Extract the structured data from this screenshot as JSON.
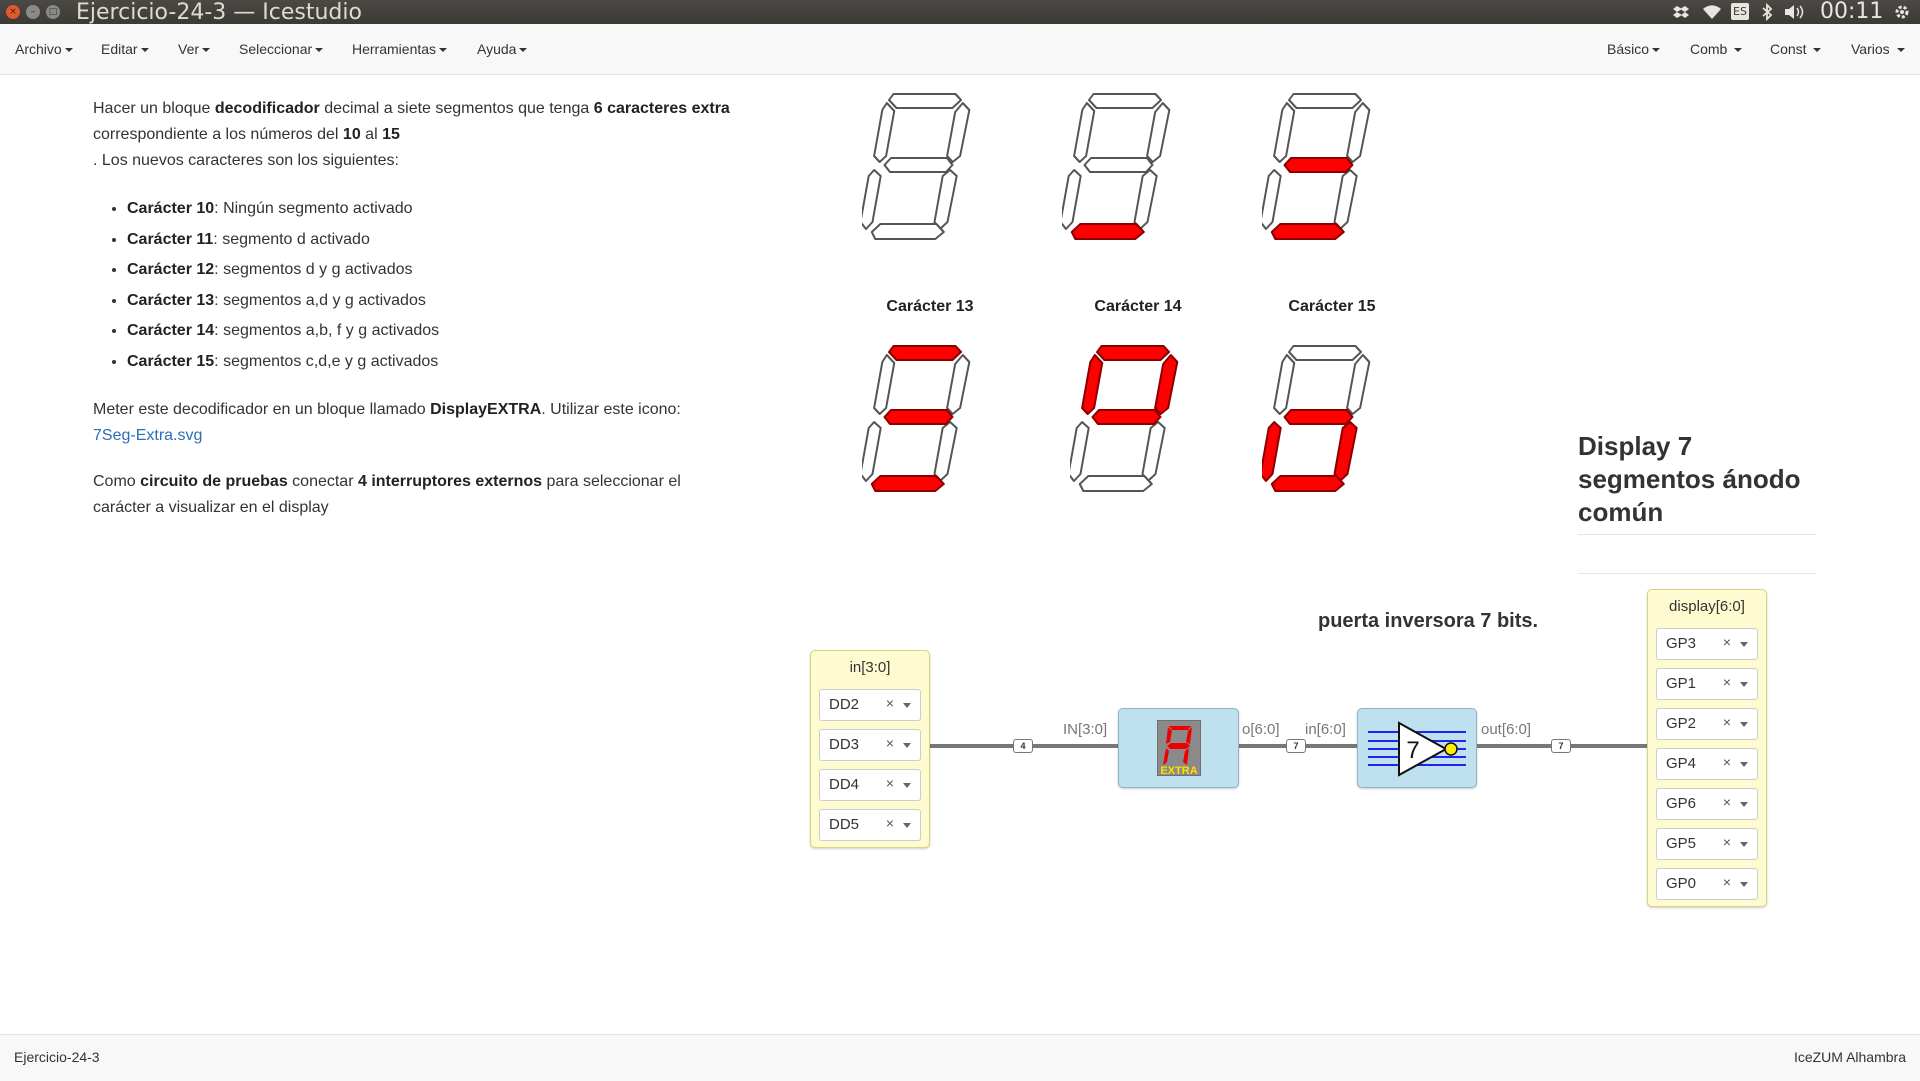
{
  "window": {
    "title": "Ejercicio-24-3 — Icestudio",
    "close_glyph": "×",
    "min_glyph": "–",
    "max_glyph": "□"
  },
  "tray": {
    "keyboard_layout": "ES",
    "clock": "00:11",
    "icons": [
      "dropbox-icon",
      "wifi-icon",
      "keyboard-icon",
      "bluetooth-icon",
      "volume-icon",
      "settings-icon"
    ]
  },
  "menu": {
    "left": [
      "Archivo",
      "Editar",
      "Ver",
      "Seleccionar",
      "Herramientas",
      "Ayuda"
    ],
    "right": [
      "Básico",
      "Comb",
      "Const",
      "Varios"
    ]
  },
  "info": {
    "p1": {
      "t1": "Hacer un bloque ",
      "b1": "decodificador",
      "t2": " decimal a siete segmentos que tenga ",
      "b2": "6 caracteres extra",
      "t3": " correspondiente a los números del ",
      "b3": "10",
      "t4": " al ",
      "b4": "15",
      "t5": ". Los nuevos caracteres son los siguientes:"
    },
    "items": [
      {
        "label": "Carácter 10",
        "desc": ": Ningún segmento activado"
      },
      {
        "label": "Carácter 11",
        "desc": ": segmento d activado"
      },
      {
        "label": "Carácter 12",
        "desc": ": segmentos d y g activados"
      },
      {
        "label": "Carácter 13",
        "desc": ": segmentos a,d y g activados"
      },
      {
        "label": "Carácter 14",
        "desc": ": segmentos a,b, f y g activados"
      },
      {
        "label": "Carácter 15",
        "desc": ": segmentos c,d,e y g activados"
      }
    ],
    "p2": {
      "t1": "Meter este decodificador en un bloque llamado ",
      "b1": "DisplayEXTRA",
      "t2": ". Utilizar este icono: ",
      "link": "7Seg-Extra.svg"
    },
    "p3": {
      "t1": "Como ",
      "b1": "circuito de pruebas",
      "t2": " conectar ",
      "b2": "4 interruptores externos",
      "t3": " para seleccionar el carácter a visualizar en el display"
    }
  },
  "digits": {
    "captions": [
      "Carácter 13",
      "Carácter 14",
      "Carácter 15"
    ],
    "on_color": "#ff0000",
    "segments_on": [
      [],
      [
        "d"
      ],
      [
        "d",
        "g"
      ],
      [
        "a",
        "d",
        "g"
      ],
      [
        "a",
        "b",
        "f",
        "g"
      ],
      [
        "c",
        "d",
        "e",
        "g"
      ]
    ]
  },
  "notes": {
    "display": "Display 7 segmentos ánodo común",
    "gate": "puerta inversora 7 bits."
  },
  "circuit": {
    "input": {
      "title": "in[3:0]",
      "pins": [
        "DD2",
        "DD3",
        "DD4",
        "DD5"
      ]
    },
    "output": {
      "title": "display[6:0]",
      "pins": [
        "GP3",
        "GP1",
        "GP2",
        "GP4",
        "GP6",
        "GP5",
        "GP0"
      ]
    },
    "pin_clear": "×",
    "wire_sizes": {
      "in": "4",
      "mid": "7",
      "out": "7"
    },
    "ports": {
      "dec_in": "IN[3:0]",
      "dec_out": "o[6:0]",
      "inv_in": "in[6:0]",
      "inv_out": "out[6:0]"
    },
    "decoder_icon_text": "EXTRA",
    "inverter_label": "7"
  },
  "status": {
    "left": "Ejercicio-24-3",
    "right": "IceZUM Alhambra"
  }
}
